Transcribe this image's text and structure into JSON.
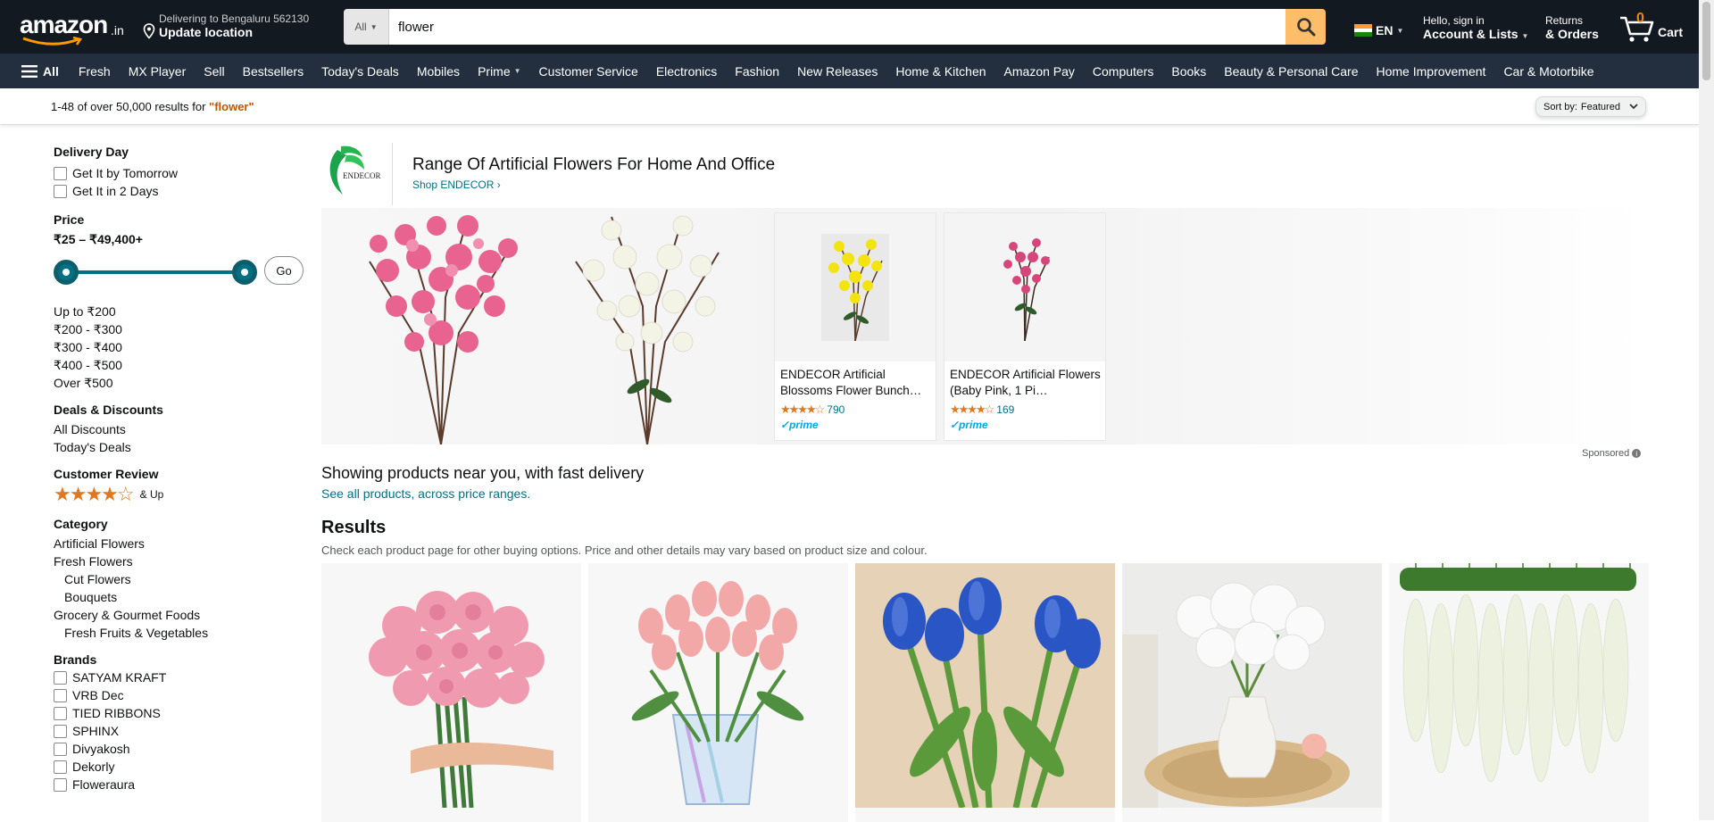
{
  "header": {
    "logo_word": "amazon",
    "logo_suffix": ".in",
    "deliver_line1": "Delivering to Bengaluru 562130",
    "deliver_line2": "Update location",
    "search_category": "All",
    "search_value": "flower",
    "lang": "EN",
    "account_line1": "Hello, sign in",
    "account_line2": "Account & Lists",
    "returns_line1": "Returns",
    "returns_line2": "& Orders",
    "cart_count": "0",
    "cart_label": "Cart"
  },
  "nav": {
    "all_label": "All",
    "items": [
      "Fresh",
      "MX Player",
      "Sell",
      "Bestsellers",
      "Today's Deals",
      "Mobiles",
      "Prime",
      "Customer Service",
      "Electronics",
      "Fashion",
      "New Releases",
      "Home & Kitchen",
      "Amazon Pay",
      "Computers",
      "Books",
      "Beauty & Personal Care",
      "Home Improvement",
      "Car & Motorbike"
    ]
  },
  "results_bar": {
    "count_text": "1-48 of over 50,000 results for ",
    "query": "\"flower\"",
    "sort_label": "Sort by:",
    "sort_value": "Featured"
  },
  "sidebar": {
    "delivery_title": "Delivery Day",
    "delivery_options": [
      "Get It by Tomorrow",
      "Get It in 2 Days"
    ],
    "price_title": "Price",
    "price_range": "₹25 – ₹49,400+",
    "go_label": "Go",
    "price_links": [
      "Up to ₹200",
      "₹200 - ₹300",
      "₹300 - ₹400",
      "₹400 - ₹500",
      "Over ₹500"
    ],
    "deals_title": "Deals & Discounts",
    "deals_links": [
      "All Discounts",
      "Today's Deals"
    ],
    "review_title": "Customer Review",
    "review_stars": "★★★★☆",
    "review_up": "& Up",
    "category_title": "Category",
    "category_links": [
      {
        "label": "Artificial Flowers",
        "indent": false
      },
      {
        "label": "Fresh Flowers",
        "indent": false
      },
      {
        "label": "Cut Flowers",
        "indent": true
      },
      {
        "label": "Bouquets",
        "indent": true
      },
      {
        "label": "Grocery & Gourmet Foods",
        "indent": false
      },
      {
        "label": "Fresh Fruits & Vegetables",
        "indent": true
      }
    ],
    "brands_title": "Brands",
    "brands": [
      "SATYAM KRAFT",
      "VRB Dec",
      "TIED RIBBONS",
      "SPHINX",
      "Divyakosh",
      "Dekorly",
      "Floweraura"
    ]
  },
  "brand_banner": {
    "logo_text": "ENDECOR",
    "title": "Range Of Artificial Flowers For Home And Office",
    "shop_link": "Shop ENDECOR ›",
    "products": [
      {
        "title": "ENDECOR Artificial Blossoms Flower Bunch…",
        "stars": "★★★★☆",
        "reviews": "790",
        "prime": "✓prime"
      },
      {
        "title": "ENDECOR Artificial Flowers (Baby Pink, 1 Pi…",
        "stars": "★★★★☆",
        "reviews": "169",
        "prime": "✓prime"
      }
    ],
    "sponsored": "Sponsored"
  },
  "near": {
    "heading": "Showing products near you, with fast delivery",
    "link": "See all products, across price ranges."
  },
  "results": {
    "heading": "Results",
    "subtext": "Check each product page for other buying options. Price and other details may vary based on product size and colour."
  },
  "colors": {
    "nav_bg": "#131921",
    "nav2_bg": "#232f3e",
    "search_btn": "#febd69",
    "link": "#007185",
    "star": "#de7921",
    "query": "#c45500"
  }
}
